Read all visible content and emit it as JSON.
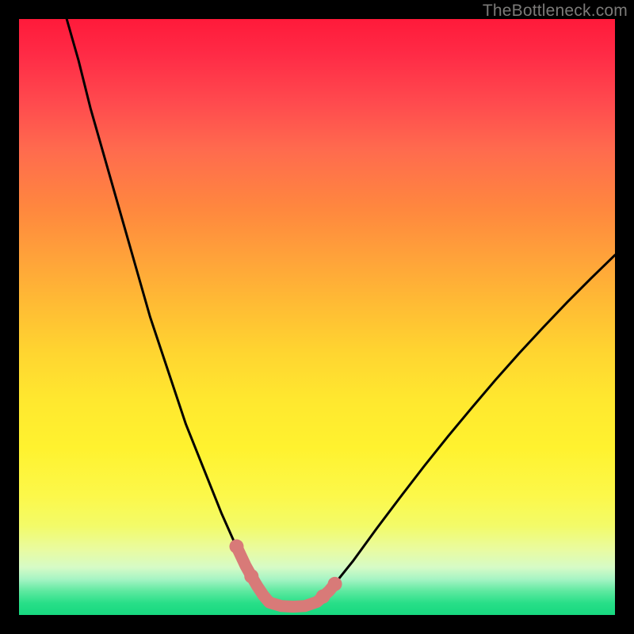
{
  "watermark": "TheBottleneck.com",
  "colors": {
    "background": "#000000",
    "curve": "#000000",
    "highlight": "#d87a78",
    "gradient_top": "#ff1a3a",
    "gradient_bottom": "#17d87f"
  },
  "chart_data": {
    "type": "line",
    "title": "",
    "xlabel": "",
    "ylabel": "",
    "xlim": [
      0,
      100
    ],
    "ylim": [
      0,
      100
    ],
    "series": [
      {
        "name": "left-curve",
        "x": [
          8,
          10,
          12,
          14,
          16,
          18,
          20,
          22,
          24,
          26,
          28,
          30,
          32,
          34,
          36,
          37,
          38,
          39,
          40,
          41,
          42
        ],
        "y": [
          100,
          93,
          85,
          78,
          71,
          64,
          57,
          50,
          44,
          38,
          32,
          27,
          22,
          17,
          12.5,
          10.3,
          8.3,
          6.5,
          4.8,
          3.3,
          2.1
        ]
      },
      {
        "name": "valley-floor",
        "x": [
          42,
          44,
          46,
          48,
          50
        ],
        "y": [
          2.1,
          1.5,
          1.4,
          1.5,
          2.2
        ]
      },
      {
        "name": "right-curve",
        "x": [
          50,
          52,
          54,
          56,
          60,
          64,
          68,
          72,
          76,
          80,
          84,
          88,
          92,
          96,
          100
        ],
        "y": [
          2.2,
          4.0,
          6.5,
          9.0,
          14.5,
          19.8,
          25.0,
          30.0,
          34.8,
          39.5,
          44.0,
          48.3,
          52.5,
          56.5,
          60.4
        ]
      }
    ],
    "highlight_region": {
      "name": "optimum-valley",
      "x": [
        36.5,
        38,
        39,
        40,
        41,
        42,
        44,
        46,
        48,
        50,
        51,
        52,
        53
      ],
      "y": [
        11.5,
        8.3,
        6.5,
        4.8,
        3.3,
        2.1,
        1.5,
        1.4,
        1.5,
        2.2,
        3.1,
        4.0,
        5.2
      ]
    }
  }
}
